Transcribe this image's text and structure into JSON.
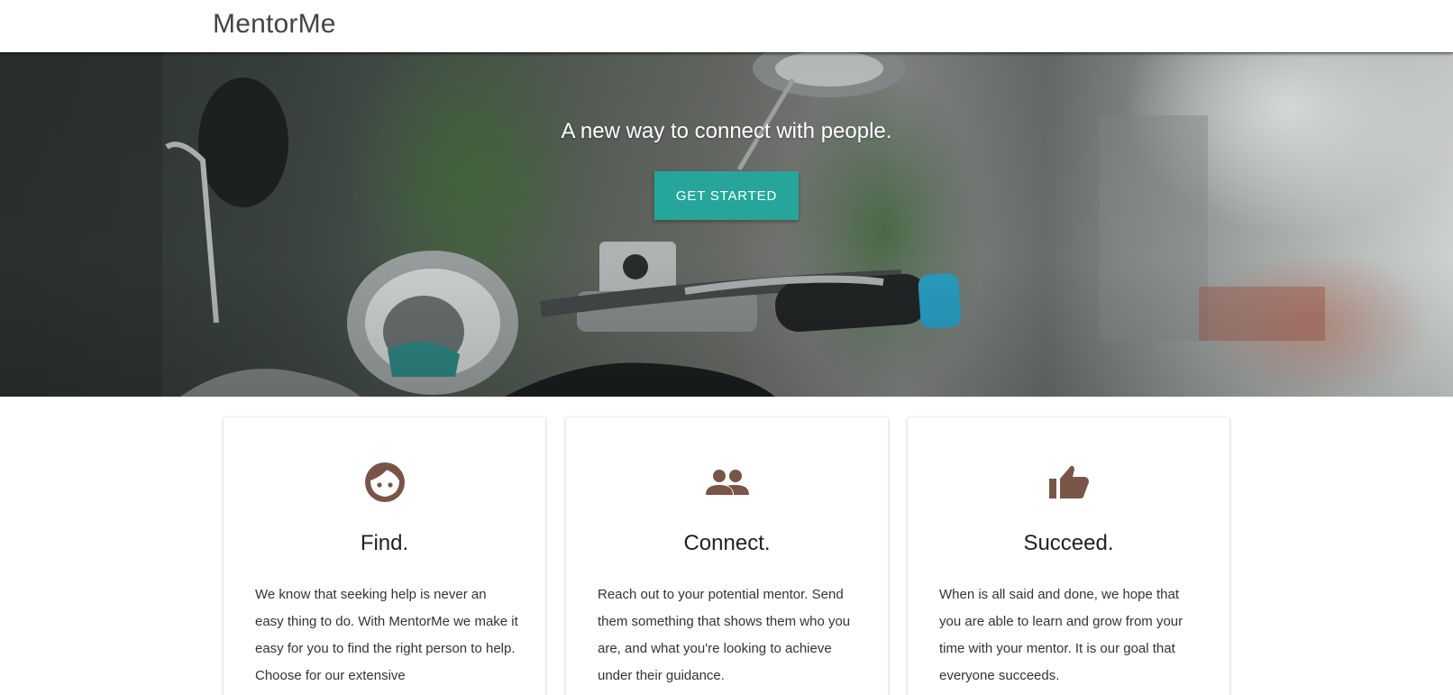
{
  "brand": {
    "name": "MentorMe"
  },
  "hero": {
    "title": "A new way to connect with people.",
    "button_label": "GET STARTED"
  },
  "features": [
    {
      "icon": "face-icon",
      "title": "Find.",
      "text": "We know that seeking help is never an easy thing to do. With MentorMe we make it easy for you to find the right person to help. Choose for our extensive"
    },
    {
      "icon": "people-icon",
      "title": "Connect.",
      "text": "Reach out to your potential mentor. Send them something that shows them who you are, and what you're looking to achieve under their guidance."
    },
    {
      "icon": "thumbs-up-icon",
      "title": "Succeed.",
      "text": "When is all said and done, we hope that you are able to learn and grow from your time with your mentor. It is our goal that everyone succeeds."
    }
  ],
  "colors": {
    "accent": "#26a69a",
    "icon": "#795548",
    "navbar_bg": "#ffffff"
  }
}
